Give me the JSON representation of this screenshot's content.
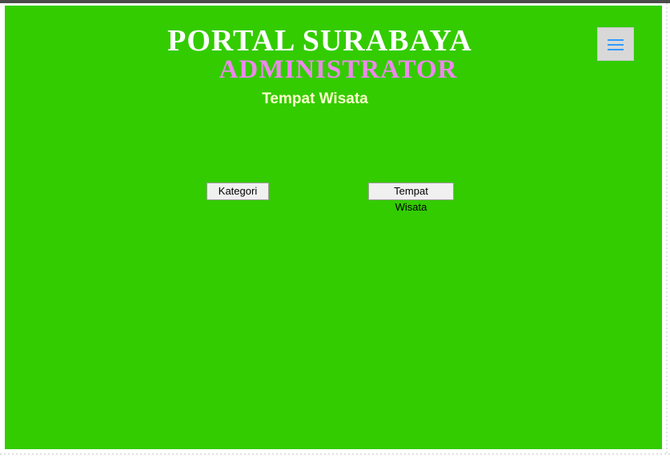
{
  "header": {
    "title": "PORTAL SURABAYA",
    "subtitle": "ADMINISTRATOR",
    "section_heading": "Tempat Wisata"
  },
  "menu": {
    "icon": "hamburger-menu-icon"
  },
  "nav": {
    "kategori_label": "Kategori",
    "tempat_wisata_label": "Tempat Wisata"
  },
  "colors": {
    "panel_background": "#33cc00",
    "title": "#ffffff",
    "subtitle": "#ee88ee",
    "section_heading": "#ffffcc",
    "menu_icon": "#3399ff"
  }
}
